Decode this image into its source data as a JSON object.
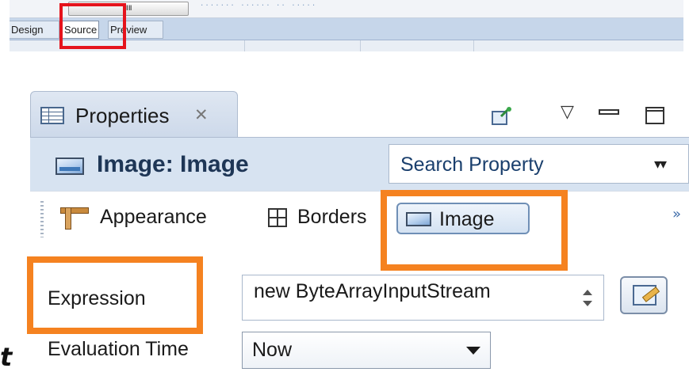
{
  "editor_tabs": {
    "tabs": [
      {
        "label": "Design"
      },
      {
        "label": "Source",
        "active": true
      },
      {
        "label": "Preview"
      }
    ]
  },
  "properties_panel": {
    "view_tab_title": "Properties",
    "view_tab_close_glyph": "✕",
    "icons": {
      "view": "properties-table-icon",
      "pin": "pin-icon",
      "menu": "view-menu-icon",
      "minimize": "minimize-icon",
      "maximize": "maximize-icon"
    },
    "object_title": "Image: Image",
    "search": {
      "placeholder": "Search Property"
    },
    "categories": [
      {
        "label": "Appearance",
        "icon": "ruler-icon"
      },
      {
        "label": "Borders",
        "icon": "borders-icon"
      },
      {
        "label": "Image",
        "icon": "image-icon",
        "active": true
      }
    ],
    "more_glyph": "»",
    "properties": {
      "expression": {
        "label": "Expression",
        "value": "new ByteArrayInputStream"
      },
      "evaluation_time": {
        "label": "Evaluation Time",
        "value": "Now"
      }
    }
  },
  "highlight_colors": {
    "red": "#e5131c",
    "orange": "#f58220"
  },
  "stray_glyph": "t"
}
